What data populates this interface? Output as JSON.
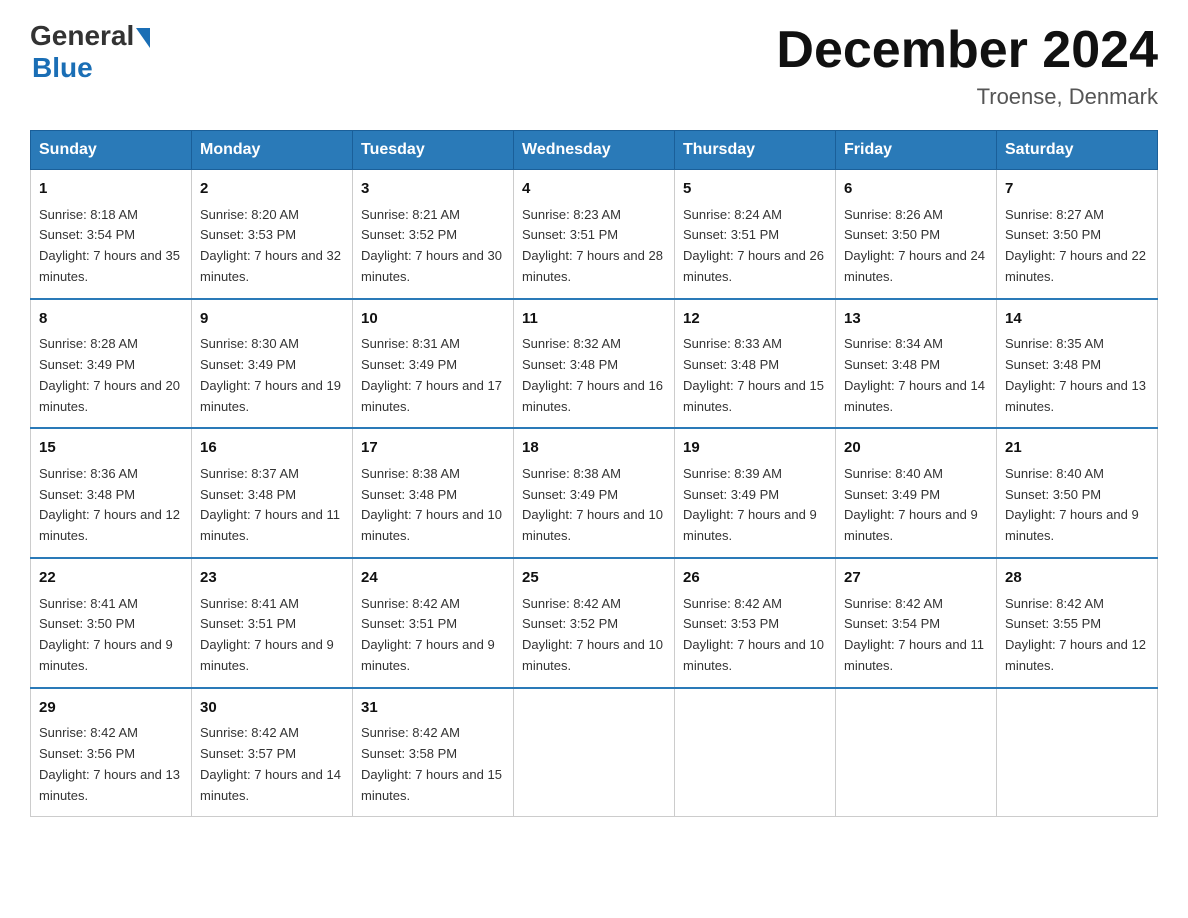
{
  "header": {
    "logo_general": "General",
    "logo_blue": "Blue",
    "month_title": "December 2024",
    "location": "Troense, Denmark"
  },
  "days_of_week": [
    "Sunday",
    "Monday",
    "Tuesday",
    "Wednesday",
    "Thursday",
    "Friday",
    "Saturday"
  ],
  "weeks": [
    [
      {
        "day": "1",
        "sunrise": "8:18 AM",
        "sunset": "3:54 PM",
        "daylight": "7 hours and 35 minutes."
      },
      {
        "day": "2",
        "sunrise": "8:20 AM",
        "sunset": "3:53 PM",
        "daylight": "7 hours and 32 minutes."
      },
      {
        "day": "3",
        "sunrise": "8:21 AM",
        "sunset": "3:52 PM",
        "daylight": "7 hours and 30 minutes."
      },
      {
        "day": "4",
        "sunrise": "8:23 AM",
        "sunset": "3:51 PM",
        "daylight": "7 hours and 28 minutes."
      },
      {
        "day": "5",
        "sunrise": "8:24 AM",
        "sunset": "3:51 PM",
        "daylight": "7 hours and 26 minutes."
      },
      {
        "day": "6",
        "sunrise": "8:26 AM",
        "sunset": "3:50 PM",
        "daylight": "7 hours and 24 minutes."
      },
      {
        "day": "7",
        "sunrise": "8:27 AM",
        "sunset": "3:50 PM",
        "daylight": "7 hours and 22 minutes."
      }
    ],
    [
      {
        "day": "8",
        "sunrise": "8:28 AM",
        "sunset": "3:49 PM",
        "daylight": "7 hours and 20 minutes."
      },
      {
        "day": "9",
        "sunrise": "8:30 AM",
        "sunset": "3:49 PM",
        "daylight": "7 hours and 19 minutes."
      },
      {
        "day": "10",
        "sunrise": "8:31 AM",
        "sunset": "3:49 PM",
        "daylight": "7 hours and 17 minutes."
      },
      {
        "day": "11",
        "sunrise": "8:32 AM",
        "sunset": "3:48 PM",
        "daylight": "7 hours and 16 minutes."
      },
      {
        "day": "12",
        "sunrise": "8:33 AM",
        "sunset": "3:48 PM",
        "daylight": "7 hours and 15 minutes."
      },
      {
        "day": "13",
        "sunrise": "8:34 AM",
        "sunset": "3:48 PM",
        "daylight": "7 hours and 14 minutes."
      },
      {
        "day": "14",
        "sunrise": "8:35 AM",
        "sunset": "3:48 PM",
        "daylight": "7 hours and 13 minutes."
      }
    ],
    [
      {
        "day": "15",
        "sunrise": "8:36 AM",
        "sunset": "3:48 PM",
        "daylight": "7 hours and 12 minutes."
      },
      {
        "day": "16",
        "sunrise": "8:37 AM",
        "sunset": "3:48 PM",
        "daylight": "7 hours and 11 minutes."
      },
      {
        "day": "17",
        "sunrise": "8:38 AM",
        "sunset": "3:48 PM",
        "daylight": "7 hours and 10 minutes."
      },
      {
        "day": "18",
        "sunrise": "8:38 AM",
        "sunset": "3:49 PM",
        "daylight": "7 hours and 10 minutes."
      },
      {
        "day": "19",
        "sunrise": "8:39 AM",
        "sunset": "3:49 PM",
        "daylight": "7 hours and 9 minutes."
      },
      {
        "day": "20",
        "sunrise": "8:40 AM",
        "sunset": "3:49 PM",
        "daylight": "7 hours and 9 minutes."
      },
      {
        "day": "21",
        "sunrise": "8:40 AM",
        "sunset": "3:50 PM",
        "daylight": "7 hours and 9 minutes."
      }
    ],
    [
      {
        "day": "22",
        "sunrise": "8:41 AM",
        "sunset": "3:50 PM",
        "daylight": "7 hours and 9 minutes."
      },
      {
        "day": "23",
        "sunrise": "8:41 AM",
        "sunset": "3:51 PM",
        "daylight": "7 hours and 9 minutes."
      },
      {
        "day": "24",
        "sunrise": "8:42 AM",
        "sunset": "3:51 PM",
        "daylight": "7 hours and 9 minutes."
      },
      {
        "day": "25",
        "sunrise": "8:42 AM",
        "sunset": "3:52 PM",
        "daylight": "7 hours and 10 minutes."
      },
      {
        "day": "26",
        "sunrise": "8:42 AM",
        "sunset": "3:53 PM",
        "daylight": "7 hours and 10 minutes."
      },
      {
        "day": "27",
        "sunrise": "8:42 AM",
        "sunset": "3:54 PM",
        "daylight": "7 hours and 11 minutes."
      },
      {
        "day": "28",
        "sunrise": "8:42 AM",
        "sunset": "3:55 PM",
        "daylight": "7 hours and 12 minutes."
      }
    ],
    [
      {
        "day": "29",
        "sunrise": "8:42 AM",
        "sunset": "3:56 PM",
        "daylight": "7 hours and 13 minutes."
      },
      {
        "day": "30",
        "sunrise": "8:42 AM",
        "sunset": "3:57 PM",
        "daylight": "7 hours and 14 minutes."
      },
      {
        "day": "31",
        "sunrise": "8:42 AM",
        "sunset": "3:58 PM",
        "daylight": "7 hours and 15 minutes."
      },
      null,
      null,
      null,
      null
    ]
  ]
}
